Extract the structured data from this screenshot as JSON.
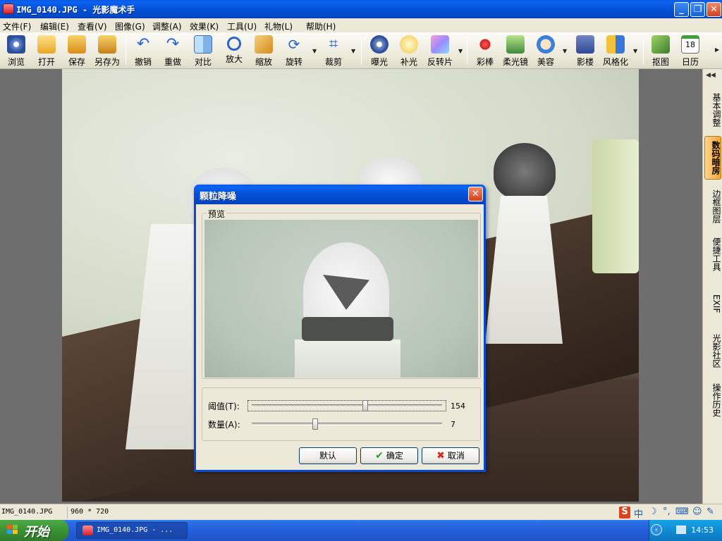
{
  "window": {
    "title": "IMG_0140.JPG - 光影魔术手"
  },
  "menu": [
    "文件(F)",
    "编辑(E)",
    "查看(V)",
    "图像(G)",
    "调整(A)",
    "效果(K)",
    "工具(U)",
    "礼物(L)",
    "帮助(H)"
  ],
  "toolbar": {
    "items": [
      {
        "label": "浏览",
        "icon": "eye-icon"
      },
      {
        "label": "打开",
        "icon": "folder-icon"
      },
      {
        "label": "保存",
        "icon": "save-icon"
      },
      {
        "label": "另存为",
        "icon": "save-as-icon"
      },
      {
        "label": "撤销",
        "icon": "undo-icon"
      },
      {
        "label": "重做",
        "icon": "redo-icon"
      },
      {
        "label": "对比",
        "icon": "compare-icon"
      },
      {
        "label": "放大",
        "icon": "zoom-in-icon"
      },
      {
        "label": "缩放",
        "icon": "resize-icon"
      },
      {
        "label": "旋转",
        "icon": "rotate-icon"
      },
      {
        "label": "裁剪",
        "icon": "crop-icon"
      },
      {
        "label": "曝光",
        "icon": "exposure-icon"
      },
      {
        "label": "补光",
        "icon": "bulb-icon"
      },
      {
        "label": "反转片",
        "icon": "film-icon"
      },
      {
        "label": "彩棒",
        "icon": "color-wand-icon"
      },
      {
        "label": "柔光镜",
        "icon": "soft-light-icon"
      },
      {
        "label": "美容",
        "icon": "beauty-icon"
      },
      {
        "label": "影楼",
        "icon": "studio-icon"
      },
      {
        "label": "风格化",
        "icon": "stylize-icon"
      },
      {
        "label": "抠图",
        "icon": "cutout-icon"
      },
      {
        "label": "日历",
        "icon": "calendar-icon"
      }
    ],
    "calendar_day": "18"
  },
  "side_tabs": [
    {
      "label": "基本调整",
      "active": false
    },
    {
      "label": "数码暗房",
      "active": true
    },
    {
      "label": "边框图层",
      "active": false
    },
    {
      "label": "便捷工具",
      "active": false
    },
    {
      "label": "EXIF",
      "active": false
    },
    {
      "label": "光影社区",
      "active": false
    },
    {
      "label": "操作历史",
      "active": false
    }
  ],
  "dialog": {
    "title": "颗粒降噪",
    "preview_label": "预览",
    "threshold": {
      "label": "阈值(T):",
      "value": "154",
      "level": 0.6
    },
    "amount": {
      "label": "数量(A):",
      "value": "7",
      "level": 0.33
    },
    "buttons": {
      "default": "默认",
      "ok": "确定",
      "cancel": "取消"
    }
  },
  "status": {
    "filename": "IMG_0140.JPG",
    "dimensions": "960 * 720"
  },
  "taskbar": {
    "start_label": "开始",
    "task_label": "IMG_0140.JPG - ...",
    "clock": "14:53",
    "ime_label": "中"
  }
}
